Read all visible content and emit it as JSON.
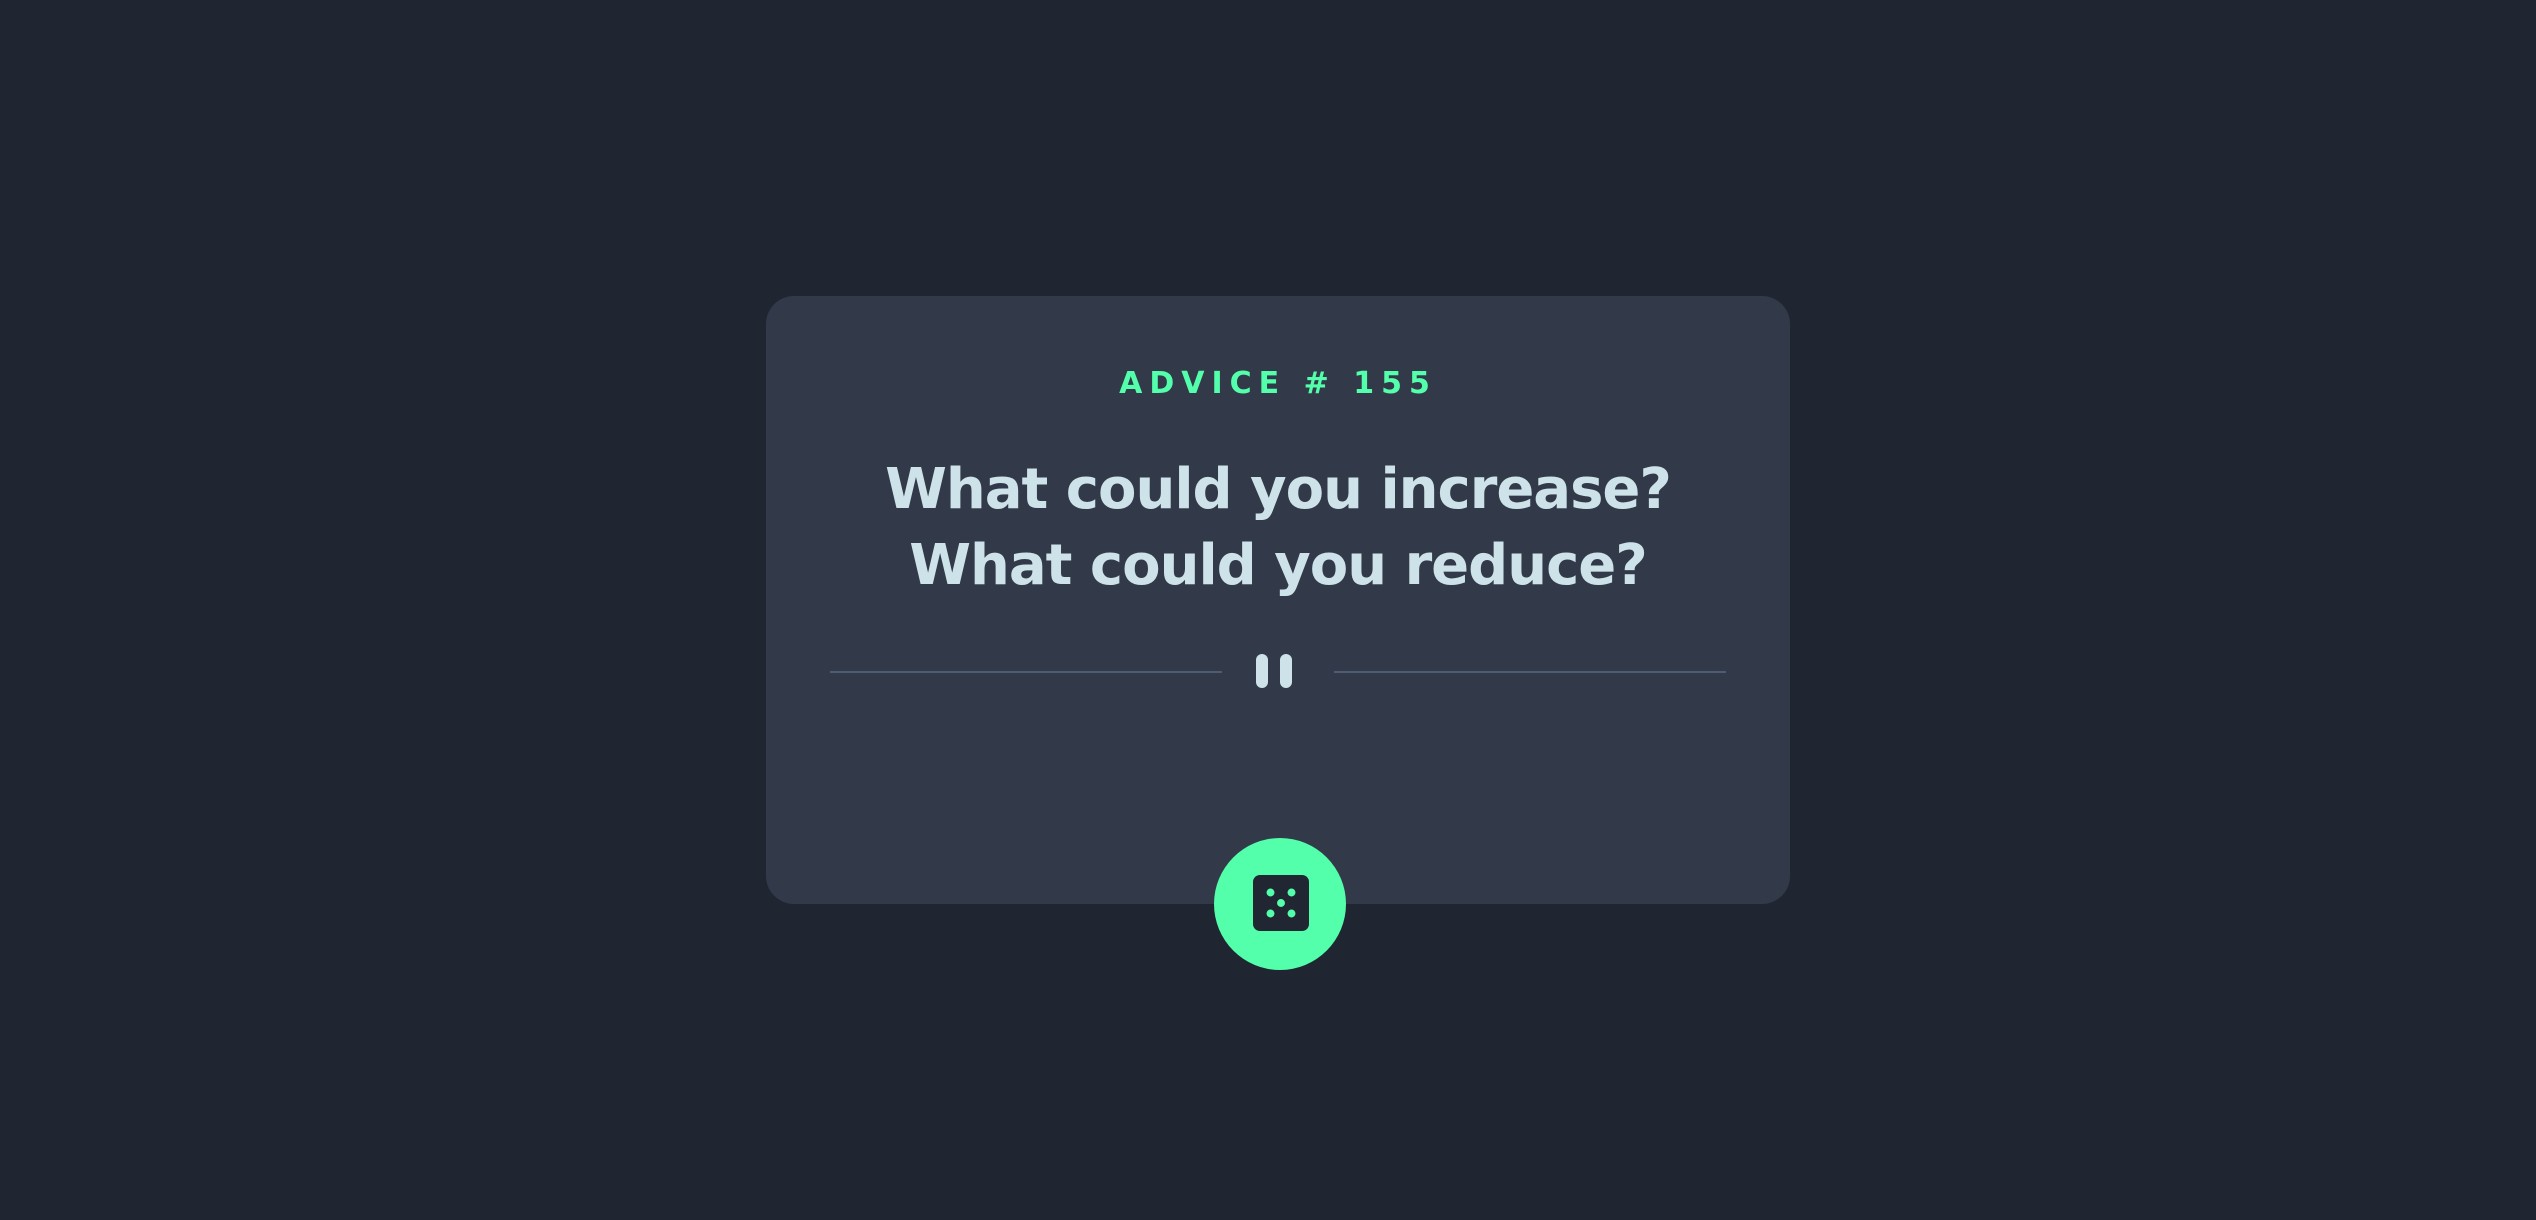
{
  "card": {
    "advice_label": "ADVICE # 155",
    "advice_text": "What could you increase? What could you reduce?"
  },
  "icons": {
    "divider": "pause-icon",
    "button": "dice-icon"
  },
  "colors": {
    "background": "#1f2632",
    "card": "#323a4a",
    "accent": "#53ffaa",
    "text": "#cee3e9",
    "divider": "#4e5d73",
    "dice": "#202632"
  }
}
